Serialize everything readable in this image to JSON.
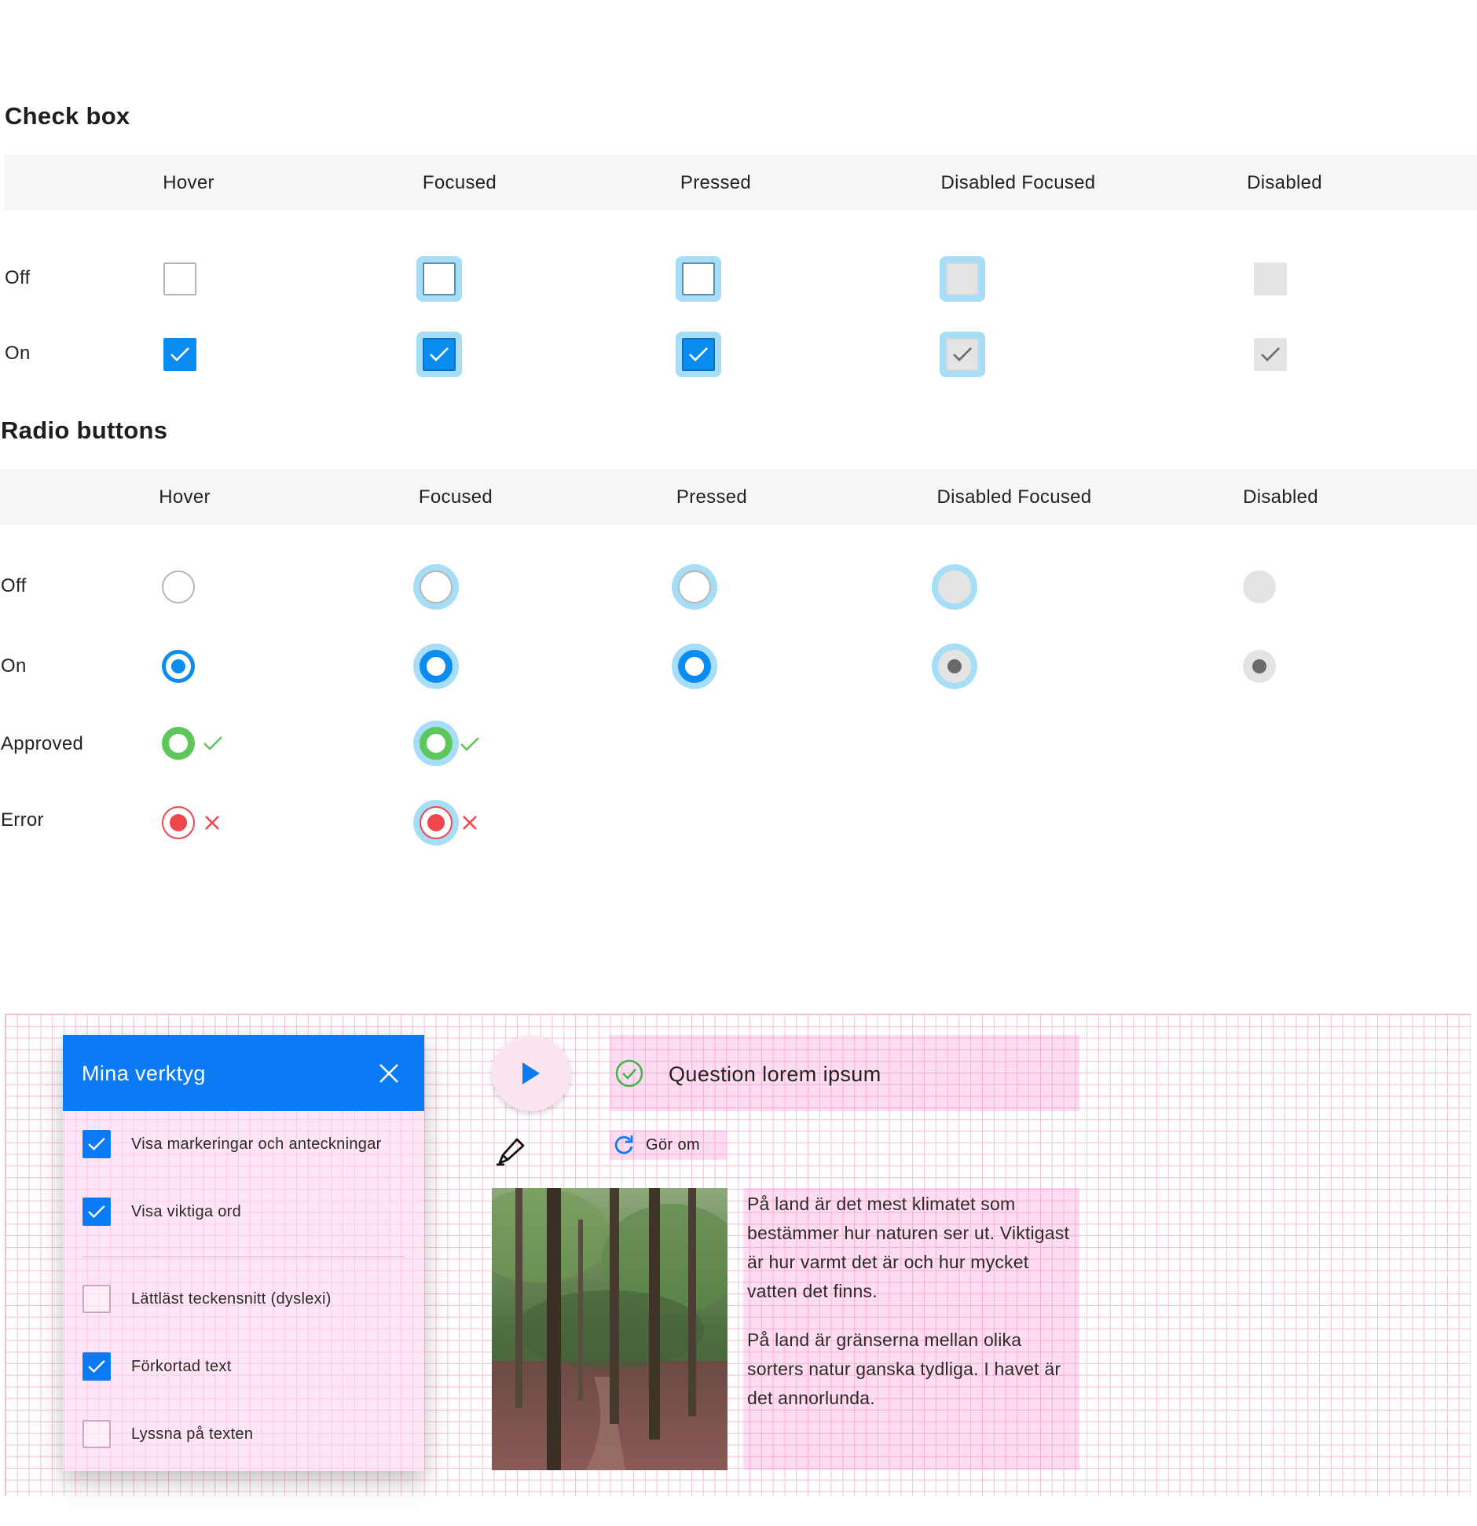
{
  "checkbox": {
    "title": "Check box",
    "columns": [
      "Hover",
      "Focused",
      "Pressed",
      "Disabled Focused",
      "Disabled"
    ],
    "rows": [
      "Off",
      "On"
    ]
  },
  "radio": {
    "title": "Radio buttons",
    "columns": [
      "Hover",
      "Focused",
      "Pressed",
      "Disabled Focused",
      "Disabled"
    ],
    "rows": [
      "Off",
      "On",
      "Approved",
      "Error"
    ]
  },
  "colors": {
    "primary": "#0a8cf1",
    "focus_ring": "#a7def7",
    "approved": "#5ec75b",
    "error": "#f0454b",
    "disabled": "#e4e4e4",
    "grid_pink": "#f6bfd6"
  },
  "tools_panel": {
    "title": "Mina verktyg",
    "close_icon": "close-icon",
    "items": [
      {
        "label": "Visa markeringar och anteckningar",
        "checked": true
      },
      {
        "label": "Visa viktiga ord",
        "checked": true
      },
      {
        "label": "Lättläst teckensnitt (dyslexi)",
        "checked": false
      },
      {
        "label": "Förkortad text",
        "checked": true
      },
      {
        "label": "Lyssna på texten",
        "checked": false
      }
    ]
  },
  "question": {
    "text": "Question lorem ipsum",
    "play_icon": "play-icon",
    "status_icon": "check-circle-icon"
  },
  "redo": {
    "label": "Gör om",
    "icon": "redo-icon"
  },
  "highlighter_icon": "highlighter-icon",
  "article": {
    "image_alt": "forest-image",
    "paragraphs": [
      "På land är det mest klimatet som bestämmer hur naturen ser ut. Viktigast är hur varmt det är och hur mycket vatten det finns.",
      "På land är gränserna mellan olika sorters natur ganska tydliga. I havet är det annorlunda."
    ]
  }
}
